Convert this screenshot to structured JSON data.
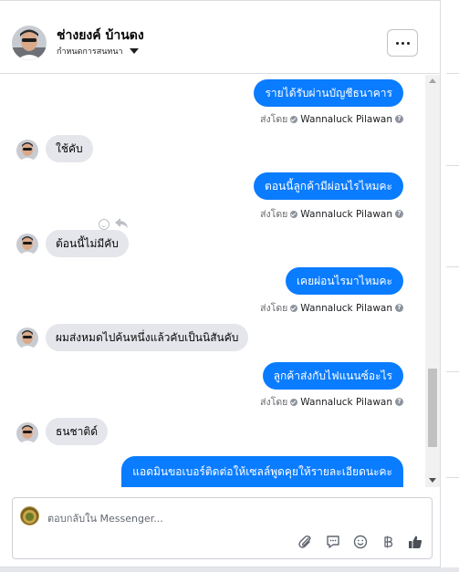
{
  "header": {
    "name": "ช่างยงค์ บ้านดง",
    "subtitle": "กำหนดการสนทนา"
  },
  "sent_by": {
    "label": "ส่งโดย",
    "agent": "Wannaluck Pilawan",
    "help": "?"
  },
  "messages": [
    {
      "dir": "out",
      "text": "รายได้รับผ่านบัญชีธนาคาร"
    },
    {
      "dir": "in",
      "text": "ใช้คับ"
    },
    {
      "dir": "out",
      "text": "ตอนนี้ลูกค้ามีผ่อนไรไหมคะ"
    },
    {
      "dir": "in",
      "text": "ต้อนนี้ไม่มีคับ"
    },
    {
      "dir": "out",
      "text": "เคยผ่อนไรมาไหมคะ"
    },
    {
      "dir": "in",
      "text": "ผมส่งหมดไปค้นหนึ่งแล้วคับเป็นนิสันคับ"
    },
    {
      "dir": "out",
      "text": "ลูกค้าส่งกับไฟแนนซ์อะไร"
    },
    {
      "dir": "in",
      "text": "ธนชาติด์"
    },
    {
      "dir": "out",
      "text": "แอดมินขอเบอร์ติดต่อให้เซลล์พูดคุยให้รายละเอียดนะคะ"
    }
  ],
  "composer": {
    "placeholder": "ตอบกลับใน Messenger..."
  },
  "icons": {
    "more": "more-icon",
    "attach": "paperclip-icon",
    "reply": "chat-bubble-icon",
    "emoji": "smile-icon",
    "currency": "baht-icon",
    "like": "thumbs-up-icon"
  },
  "colors": {
    "outgoing_bubble": "#0a7cff",
    "incoming_bubble": "#e4e6eb"
  }
}
